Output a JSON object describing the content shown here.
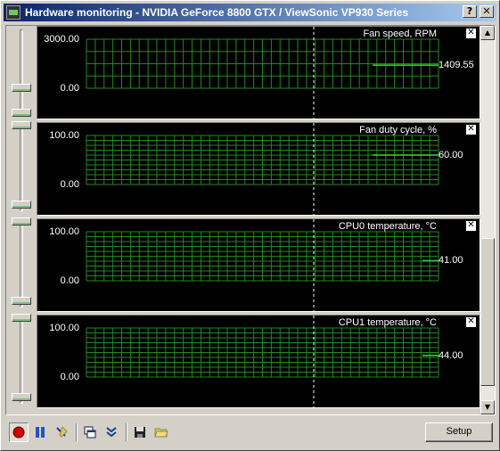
{
  "window": {
    "title": "Hardware monitoring - NVIDIA GeForce 8800 GTX / ViewSonic VP930 Series",
    "help_label": "?",
    "close_label": "✕"
  },
  "colors": {
    "grid": "#1f8a1f",
    "line": "#33dd33",
    "background": "#000000",
    "marker": "#ffffff"
  },
  "graphs": [
    {
      "title": "Fan speed, RPM",
      "ymax": "3000.00",
      "ymin": "0.00",
      "current": "1409.55",
      "min": 0,
      "max": 3000,
      "value": 1409.55,
      "close_label": "✕"
    },
    {
      "title": "Fan duty cycle, %",
      "ymax": "100.00",
      "ymin": "0.00",
      "current": "60.00",
      "min": 0,
      "max": 100,
      "value": 60,
      "close_label": "✕"
    },
    {
      "title": "CPU0 temperature, °C",
      "ymax": "100.00",
      "ymin": "0.00",
      "current": "41.00",
      "min": 0,
      "max": 100,
      "value": 41,
      "close_label": "✕"
    },
    {
      "title": "CPU1 temperature, °C",
      "ymax": "100.00",
      "ymin": "0.00",
      "current": "44.00",
      "min": 0,
      "max": 100,
      "value": 44,
      "close_label": "✕"
    }
  ],
  "toolbar": {
    "setup_label": "Setup",
    "icons": [
      "record-icon",
      "pause-icon",
      "clear-icon",
      "detach-icon",
      "expand-icon",
      "save-icon",
      "open-icon"
    ]
  }
}
